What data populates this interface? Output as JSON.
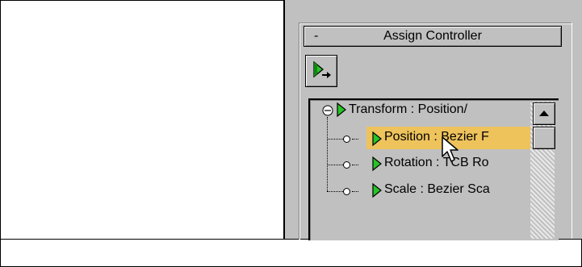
{
  "rollout": {
    "collapse_symbol": "-",
    "title": "Assign Controller"
  },
  "toolbar": {
    "assign_button_icon": "assign-controller-icon"
  },
  "tree": {
    "root": {
      "label": "Transform : Position/",
      "expand_symbol": "⊖",
      "icon": "controller-arrow-icon"
    },
    "children": [
      {
        "label": "Position : Bezier F",
        "icon": "controller-arrow-icon",
        "selected": true
      },
      {
        "label": "Rotation : TCB Ro",
        "icon": "controller-arrow-icon",
        "selected": false
      },
      {
        "label": "Scale : Bezier Sca",
        "icon": "controller-arrow-icon",
        "selected": false
      }
    ]
  },
  "scrollbar": {
    "up_icon": "arrow-up-icon"
  },
  "colors": {
    "panel_bg": "#c0c0c0",
    "selection": "#eec35c",
    "controller_icon": "#27c427"
  },
  "cursor": "mouse-pointer-icon"
}
